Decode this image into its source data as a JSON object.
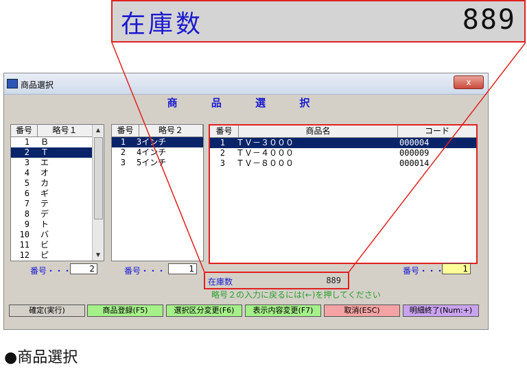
{
  "zoom": {
    "label": "在庫数",
    "value": "889"
  },
  "window": {
    "title": "商品選択",
    "close_glyph": "x",
    "heading": "商 品 選 択"
  },
  "list1": {
    "headers": [
      "番号",
      "略号１"
    ],
    "rows": [
      {
        "no": "1",
        "name": "Ｂ"
      },
      {
        "no": "2",
        "name": "Ｔ"
      },
      {
        "no": "3",
        "name": "エ"
      },
      {
        "no": "4",
        "name": "オ"
      },
      {
        "no": "5",
        "name": "カ"
      },
      {
        "no": "6",
        "name": "ギ"
      },
      {
        "no": "7",
        "name": "テ"
      },
      {
        "no": "8",
        "name": "デ"
      },
      {
        "no": "9",
        "name": "ト"
      },
      {
        "no": "10",
        "name": "バ"
      },
      {
        "no": "11",
        "name": "ビ"
      },
      {
        "no": "12",
        "name": "ピ"
      }
    ],
    "selected_index": 1,
    "field_label": "番号・・・",
    "field_value": "2"
  },
  "list2": {
    "headers": [
      "番号",
      "略号２"
    ],
    "rows": [
      {
        "no": "1",
        "name": "3インチ"
      },
      {
        "no": "2",
        "name": "4インチ"
      },
      {
        "no": "3",
        "name": "5インチ"
      }
    ],
    "selected_index": 0,
    "field_label": "番号・・・",
    "field_value": "1"
  },
  "list3": {
    "headers": [
      "番号",
      "商品名",
      "コード"
    ],
    "rows": [
      {
        "no": "1",
        "name": "ＴＶ－３０００",
        "code": "000004"
      },
      {
        "no": "2",
        "name": "ＴＶ－４０００",
        "code": "000009"
      },
      {
        "no": "3",
        "name": "ＴＶ－８０００",
        "code": "000014"
      }
    ],
    "selected_index": 0,
    "field_label": "番号・・・",
    "field_value": "1"
  },
  "stock": {
    "label": "在庫数",
    "value": "889"
  },
  "hint": "略号２の入力に戻るには(←)を押してください",
  "buttons": [
    {
      "label": "確定(実行)",
      "color": "#d4d0c8"
    },
    {
      "label": "商品登録(F5)",
      "color": "#a6f08a"
    },
    {
      "label": "選択区分変更(F6)",
      "color": "#a6f08a"
    },
    {
      "label": "表示内容変更(F7)",
      "color": "#a6f08a"
    },
    {
      "label": "取消(ESC)",
      "color": "#f3a3a3"
    },
    {
      "label": "明細終了(Num:+)",
      "color": "#c9a3ee"
    }
  ],
  "caption": "●商品選択",
  "colors": {
    "accent_blue": "#1a1ad0",
    "highlight_red": "#e02020",
    "selection": "#0a246a"
  }
}
